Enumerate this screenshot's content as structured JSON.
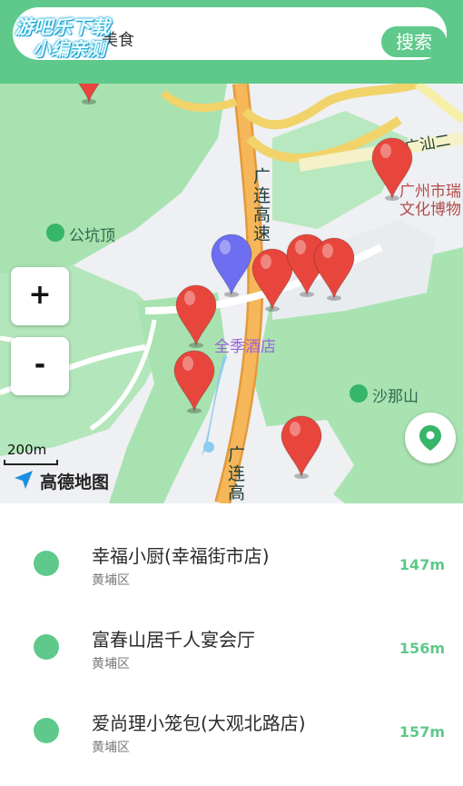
{
  "header": {
    "back_icon": "back-arrow-icon",
    "search_query": "美食",
    "search_button": "搜索",
    "watermark_line1": "游吧乐下载",
    "watermark_line2": "小编亲测"
  },
  "map": {
    "zoom_in": "+",
    "zoom_out": "-",
    "scale": "200m",
    "logo": "高德地图",
    "labels": {
      "poi_gongkengding": "公坑顶",
      "poi_shanashan": "沙那山",
      "hotel": "全季酒店",
      "museum_line1": "广州市瑞",
      "museum_line2": "文化博物",
      "road_guanglian": "广连高速",
      "road_guanglian_lower": "广连高",
      "road_guangshan": "广汕二"
    },
    "marker_color": "#e8463c",
    "current_location_color": "#6d6ff0"
  },
  "results": [
    {
      "name": "幸福小厨(幸福街市店)",
      "district": "黄埔区",
      "distance": "147m"
    },
    {
      "name": "富春山居千人宴会厅",
      "district": "黄埔区",
      "distance": "156m"
    },
    {
      "name": "爱尚理小笼包(大观北路店)",
      "district": "黄埔区",
      "distance": "157m"
    }
  ],
  "colors": {
    "accent": "#5ec98a"
  }
}
